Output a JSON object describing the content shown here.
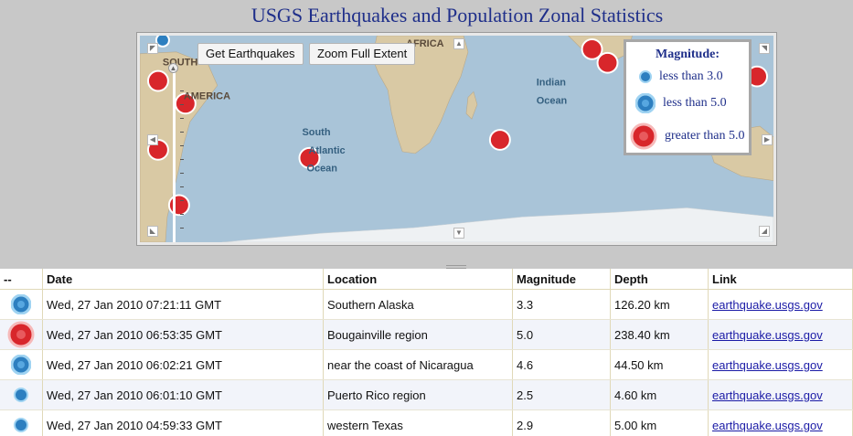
{
  "page": {
    "title": "USGS Earthquakes and Population Zonal Statistics"
  },
  "map": {
    "buttons": {
      "get_earthquakes": "Get Earthquakes",
      "zoom_full_extent": "Zoom Full Extent"
    },
    "labels": {
      "south_america": "SOUTH AMERICA",
      "africa": "AFRICA",
      "indian_ocean": "Indian Ocean",
      "south_atlantic_ocean": "South Atlantic Ocean"
    },
    "colors": {
      "ocean": "#a9c4d8",
      "land": "#d9c9a4",
      "quake_large": "#d8262b",
      "quake_small": "#2d7fc0"
    }
  },
  "legend": {
    "title": "Magnitude:",
    "items": [
      {
        "label": "less than 3.0",
        "icon": "quake-small-icon"
      },
      {
        "label": "less than 5.0",
        "icon": "quake-medium-icon"
      },
      {
        "label": "greater than 5.0",
        "icon": "quake-large-icon"
      }
    ]
  },
  "table": {
    "headers": [
      "--",
      "Date",
      "Location",
      "Magnitude",
      "Depth",
      "Link"
    ],
    "rows": [
      {
        "icon": "quake-medium-icon",
        "date": "Wed, 27 Jan 2010 07:21:11 GMT",
        "location": "Southern Alaska",
        "magnitude": "3.3",
        "depth": "126.20 km",
        "link": "earthquake.usgs.gov"
      },
      {
        "icon": "quake-large-icon",
        "date": "Wed, 27 Jan 2010 06:53:35 GMT",
        "location": "Bougainville region",
        "magnitude": "5.0",
        "depth": "238.40 km",
        "link": "earthquake.usgs.gov"
      },
      {
        "icon": "quake-medium-icon",
        "date": "Wed, 27 Jan 2010 06:02:21 GMT",
        "location": "near the coast of Nicaragua",
        "magnitude": "4.6",
        "depth": "44.50 km",
        "link": "earthquake.usgs.gov"
      },
      {
        "icon": "quake-small-icon",
        "date": "Wed, 27 Jan 2010 06:01:10 GMT",
        "location": "Puerto Rico region",
        "magnitude": "2.5",
        "depth": "4.60 km",
        "link": "earthquake.usgs.gov"
      },
      {
        "icon": "quake-small-icon",
        "date": "Wed, 27 Jan 2010 04:59:33 GMT",
        "location": "western Texas",
        "magnitude": "2.9",
        "depth": "5.00 km",
        "link": "earthquake.usgs.gov"
      }
    ]
  }
}
